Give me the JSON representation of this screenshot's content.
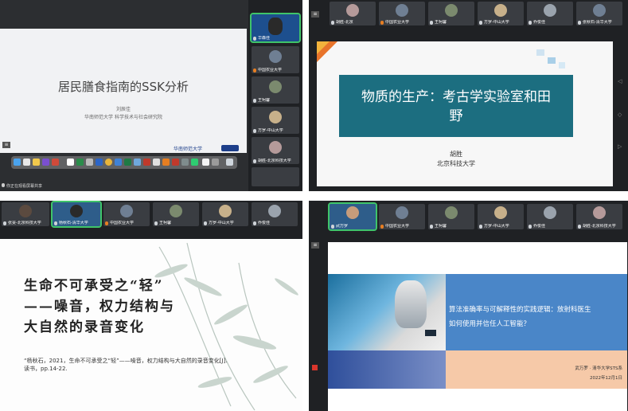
{
  "panel1": {
    "slide_title": "居民膳食指南的SSK分析",
    "author": "刘辰佳",
    "affiliation": "华南师范大学 科学技术与社会研究院",
    "logo_text": "华南师范大学",
    "sidebar": [
      {
        "name": "华森佳"
      },
      {
        "name": "中国农业大学"
      },
      {
        "name": "王柯馨"
      },
      {
        "name": "方罗-中山大学"
      },
      {
        "name": "胡胜-北京科技大学"
      }
    ],
    "share_label": "你正在观看屏幕共享"
  },
  "panel2": {
    "thumbs": [
      {
        "name": "胡胜-北京"
      },
      {
        "name": "中国农业大学"
      },
      {
        "name": "王柯馨"
      },
      {
        "name": "方罗-中山大学"
      },
      {
        "name": "乔俊佳"
      },
      {
        "name": "张秋石-清华大学"
      }
    ],
    "title_line1": "物质的生产：考古学实验室和田",
    "title_line2": "野",
    "author": "胡胜",
    "affiliation": "北京科技大学",
    "accent": "#1c6e80"
  },
  "panel3": {
    "thumbs": [
      {
        "name": "张旻-北京科技大学"
      },
      {
        "name": "杨秋石-清华大学"
      },
      {
        "name": "中国农业大学"
      },
      {
        "name": "王柯馨"
      },
      {
        "name": "方罗-中山大学"
      },
      {
        "name": "乔俊佳"
      }
    ],
    "title_line1": "生命不可承受之“轻”",
    "title_line2": "——噪音，权力结构与",
    "title_line3": "大自然的录音变化",
    "citation": "“杨秋石，2021，生命不可承受之“轻”——噪音，权力结构与大自然的录音变化[J]. 读书，pp.14-22."
  },
  "panel4": {
    "thumbs": [
      {
        "name": "武万罗"
      },
      {
        "name": "中国农业大学"
      },
      {
        "name": "王柯馨"
      },
      {
        "name": "方罗-中山大学"
      },
      {
        "name": "乔俊佳"
      },
      {
        "name": "胡胜-北京科技大学"
      }
    ],
    "title_line1": "算法准确率与可解释性的实践逻辑：放射科医生",
    "title_line2": "如何使用并信任人工智能？",
    "author": "武万罗 · 清华大学STS系",
    "date": "2022年12月1日",
    "accent_blue": "#4a86c8",
    "accent_peach": "#f6c9a8"
  }
}
